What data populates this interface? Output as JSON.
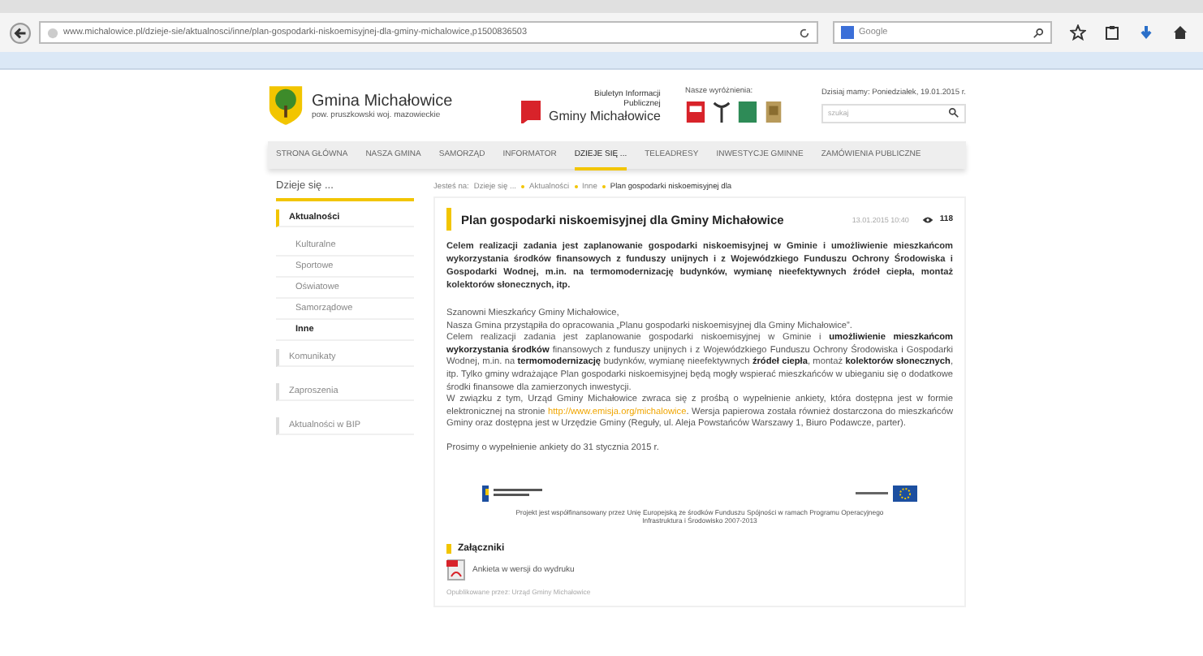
{
  "browser": {
    "url": "www.michalowice.pl/dzieje-sie/aktualnosci/inne/plan-gospodarki-niskoemisyjnej-dla-gminy-michalowice,p1500836503",
    "search_placeholder": "Google"
  },
  "header": {
    "site_name": "Gmina Michałowice",
    "site_subtitle": "pow. pruszkowski woj. mazowieckie",
    "bip_label": "Biuletyn Informacji Publicznej",
    "bip_name": "Gminy Michałowice",
    "awards_label": "Nasze wyróżnienia:",
    "date": "Dzisiaj mamy: Poniedziałek, 19.01.2015 r.",
    "search_placeholder": "szukaj"
  },
  "nav": [
    {
      "label": "STRONA GŁÓWNA",
      "selected": false
    },
    {
      "label": "NASZA GMINA",
      "selected": false
    },
    {
      "label": "SAMORZĄD",
      "selected": false
    },
    {
      "label": "INFORMATOR",
      "selected": false
    },
    {
      "label": "DZIEJE SIĘ ...",
      "selected": true
    },
    {
      "label": "TELEADRESY",
      "selected": false
    },
    {
      "label": "INWESTYCJE GMINNE",
      "selected": false
    },
    {
      "label": "ZAMÓWIENIA PUBLICZNE",
      "selected": false
    }
  ],
  "sidebar": {
    "title": "Dzieje się ...",
    "items": [
      {
        "label": "Aktualności",
        "selected": true,
        "children": [
          {
            "label": "Kulturalne",
            "selected": false
          },
          {
            "label": "Sportowe",
            "selected": false
          },
          {
            "label": "Oświatowe",
            "selected": false
          },
          {
            "label": "Samorządowe",
            "selected": false
          },
          {
            "label": "Inne",
            "selected": true
          }
        ]
      },
      {
        "label": "Komunikaty",
        "selected": false
      },
      {
        "label": "Zaproszenia",
        "selected": false
      },
      {
        "label": "Aktualności w BIP",
        "selected": false
      }
    ]
  },
  "breadcrumb": {
    "prefix": "Jesteś na:",
    "items": [
      "Dzieje się ...",
      "Aktualności",
      "Inne",
      "Plan gospodarki niskoemisyjnej dla"
    ]
  },
  "article": {
    "title": "Plan gospodarki niskoemisyjnej dla Gminy Michałowice",
    "date": "13.01.2015 10:40",
    "views": "118",
    "lead": "Celem realizacji zadania jest zaplanowanie gospodarki niskoemisyjnej w Gminie i umożliwienie mieszkańcom wykorzystania środków finansowych z funduszy unijnych i z Wojewódzkiego Funduszu Ochrony Środowiska i Gospodarki Wodnej, m.in. na termomodernizację budynków, wymianę nieefektywnych źródeł ciepła, montaż kolektorów słonecznych, itp.",
    "greeting": "Szanowni Mieszkańcy Gminy Michałowice,",
    "intro": "Nasza Gmina przystąpiła do opracowania „Planu gospodarki niskoemisyjnej dla Gminy Michałowice”.",
    "body": "Celem realizacji zadania jest zaplanowanie gospodarki niskoemisyjnej w Gminie i **umożliwienie mieszkańcom wykorzystania środków** finansowych z funduszy unijnych i z Wojewódzkiego Funduszu Ochrony Środowiska i Gospodarki Wodnej, m.in. na **termomodernizację** budynków, wymianę nieefektywnych **źródeł ciepła**, montaż **kolektorów słonecznych**, itp. Tylko gminy wdrażające Plan gospodarki niskoemisyjnej będą mogły wspierać mieszkańców w ubieganiu się o dodatkowe środki finansowe dla zamierzonych inwestycji.",
    "survey_before": "W związku z tym, Urząd Gminy Michałowice zwraca się z prośbą o wypełnienie ankiety, która dostępna jest w formie elektronicznej na stronie",
    "survey_link": "http://www.emisja.org/michalowice",
    "survey_after": ". Wersja papierowa została również dostarczona do mieszkańców Gminy oraz dostępna jest w Urzędzie Gminy (Reguły, ul. Aleja Powstańców Warszawy 1, Biuro Podawcze, parter).",
    "deadline": "Prosimy o wypełnienie ankiety do 31 stycznia 2015 r.",
    "funding": "Projekt jest współfinansowany przez Unię Europejską ze środków Funduszu Spójności w ramach Programu Operacyjnego Infrastruktura i Środowisko 2007-2013",
    "attachments_title": "Załączniki",
    "attachments": [
      "Ankieta w wersji do wydruku"
    ],
    "published_by": "Opublikowane przez: Urząd Gminy Michałowice"
  }
}
